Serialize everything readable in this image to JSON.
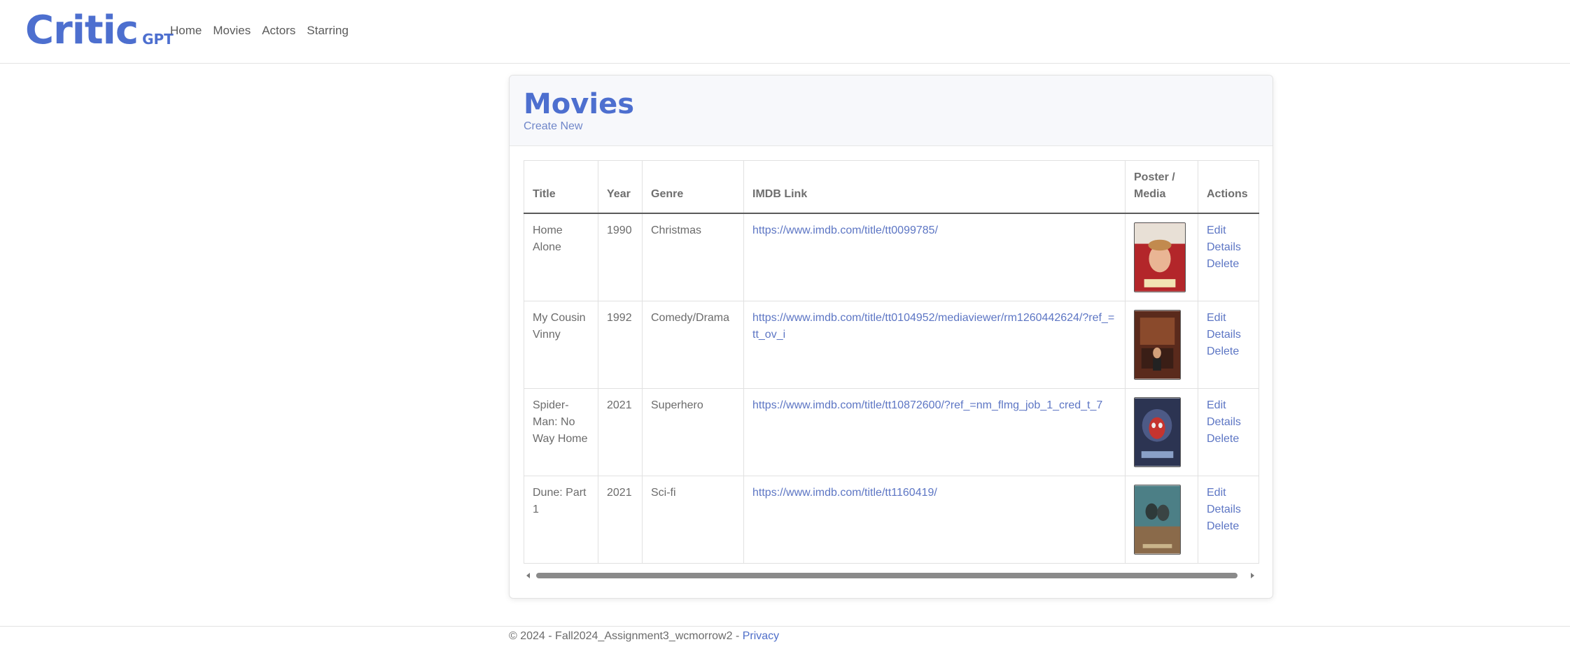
{
  "brand": {
    "main": "Critic",
    "sub": "GPT"
  },
  "nav": [
    {
      "label": "Home"
    },
    {
      "label": "Movies"
    },
    {
      "label": "Actors"
    },
    {
      "label": "Starring"
    }
  ],
  "page": {
    "title": "Movies",
    "create_label": "Create New"
  },
  "table": {
    "headers": [
      "Title",
      "Year",
      "Genre",
      "IMDB Link",
      "Poster / Media",
      "Actions"
    ],
    "actions": [
      "Edit",
      "Details",
      "Delete"
    ],
    "rows": [
      {
        "title": "Home Alone",
        "year": "1990",
        "genre": "Christmas",
        "link": "https://www.imdb.com/title/tt0099785/",
        "poster_color": "#b3262a"
      },
      {
        "title": "My Cousin Vinny",
        "year": "1992",
        "genre": "Comedy/Drama",
        "link": "https://www.imdb.com/title/tt0104952/mediaviewer/rm1260442624/?ref_=tt_ov_i",
        "poster_color": "#7a3b26"
      },
      {
        "title": "Spider-Man: No Way Home",
        "year": "2021",
        "genre": "Superhero",
        "link": "https://www.imdb.com/title/tt10872600/?ref_=nm_flmg_job_1_cred_t_7",
        "poster_color": "#3b4569"
      },
      {
        "title": "Dune: Part 1",
        "year": "2021",
        "genre": "Sci-fi",
        "link": "https://www.imdb.com/title/tt1160419/",
        "poster_color": "#4c7f86"
      }
    ]
  },
  "footer": {
    "text": "© 2024 - Fall2024_Assignment3_wcmorrow2 - ",
    "privacy": "Privacy"
  },
  "colors": {
    "accent": "#4d6fcf",
    "link": "#5d76c4"
  }
}
